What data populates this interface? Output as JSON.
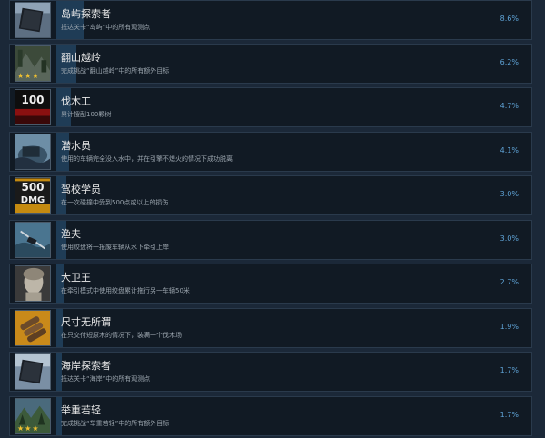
{
  "achievements": [
    {
      "title": "岛屿探索者",
      "description": "抵达关卡“岛屿”中的所有观测点",
      "percent": "8.6%",
      "percent_value": 8.6,
      "icon": "flag-icon"
    },
    {
      "title": "翻山越岭",
      "description": "完成挑战“翻山越岭”中的所有额外目标",
      "percent": "6.2%",
      "percent_value": 6.2,
      "icon": "mountain-stars-icon"
    },
    {
      "title": "伐木工",
      "description": "累计搜刮100颗树",
      "percent": "4.7%",
      "percent_value": 4.7,
      "icon": "lumberjack-100-icon",
      "icon_text": "100"
    },
    {
      "title": "潜水员",
      "description": "使用的车辆完全没入水中，并在引擎不熄火的情况下成功脱离",
      "percent": "4.1%",
      "percent_value": 4.1,
      "icon": "diver-truck-icon"
    },
    {
      "title": "驾校学员",
      "description": "在一次碰撞中受到500点或以上的损伤",
      "percent": "3.0%",
      "percent_value": 3.0,
      "icon": "damage-500-icon",
      "icon_text": "500",
      "icon_subtext": "DMG"
    },
    {
      "title": "渔夫",
      "description": "使用绞盘将一报废车辆从水下牵引上岸",
      "percent": "3.0%",
      "percent_value": 3.0,
      "icon": "fisherman-winch-icon"
    },
    {
      "title": "大卫王",
      "description": "在牵引模式中使用绞盘累计拖行另一车辆50米",
      "percent": "2.7%",
      "percent_value": 2.7,
      "icon": "david-statue-icon"
    },
    {
      "title": "尺寸无所谓",
      "description": "在只交付短原木的情况下，装满一个伐木场",
      "percent": "1.9%",
      "percent_value": 1.9,
      "icon": "short-logs-icon"
    },
    {
      "title": "海岸探索者",
      "description": "抵达关卡“海岸”中的所有观测点",
      "percent": "1.7%",
      "percent_value": 1.7,
      "icon": "coast-flag-icon"
    },
    {
      "title": "举重若轻",
      "description": "完成挑战“举重若轻”中的所有额外目标",
      "percent": "1.7%",
      "percent_value": 1.7,
      "icon": "forest-stars-icon"
    }
  ],
  "stars": "★★★"
}
